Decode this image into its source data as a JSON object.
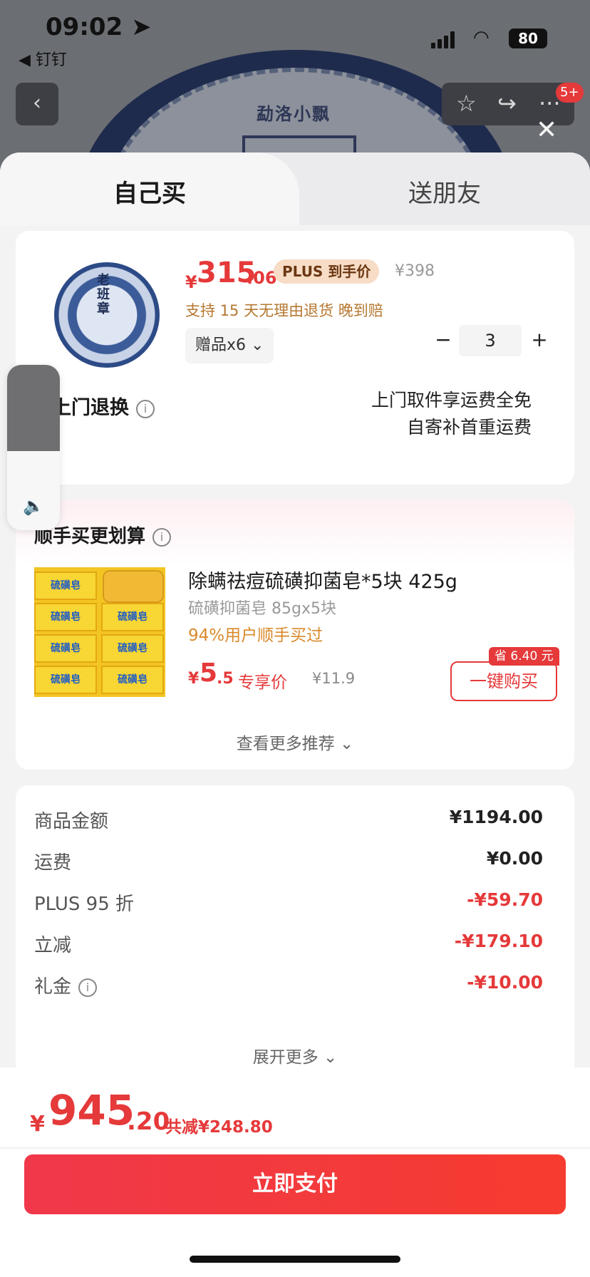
{
  "status_bar": {
    "time": "09:02",
    "back_app": "◀ 钉钉",
    "battery": "80"
  },
  "background": {
    "logo_text": "勐洛小飘",
    "badge": "5+"
  },
  "tabs": [
    {
      "label": "自己买",
      "active": true
    },
    {
      "label": "送朋友",
      "active": false
    }
  ],
  "product": {
    "image_text": "老班章",
    "currency": "¥",
    "price_int": "315",
    "price_dec": ".06",
    "plus_tag": "PLUS 到手价",
    "original_price": "¥398",
    "return_policy": "支持 15 天无理由退货   晚到赔",
    "gift": "赠品x6",
    "quantity": "3",
    "service_title": "费上门退换",
    "service_line1": "上门取件享运费全免",
    "service_line2": "自寄补首重运费"
  },
  "volume": {
    "level": 0.52
  },
  "cross_sell": {
    "title": "顺手买更划算",
    "item": {
      "name": "除螨祛痘硫磺抑菌皂*5块 425g",
      "spec": "硫磺抑菌皂 85gx5块",
      "social_proof": "94%用户顺手买过",
      "currency": "¥",
      "price_int": "5",
      "price_dec": ".5",
      "exclusive_label": "专享价",
      "original_price": "¥11.9",
      "save_tag": "省 6.40 元",
      "buy_label": "一键购买",
      "pack_text": "硫磺皂"
    },
    "more_label": "查看更多推荐 ⌄"
  },
  "summary": {
    "rows": [
      {
        "label": "商品金额",
        "value": "¥1194.00",
        "color": "#222222"
      },
      {
        "label": "运费",
        "value": "¥0.00",
        "color": "#222222"
      },
      {
        "label": "PLUS 95 折",
        "value": "-¥59.70",
        "color": "#e5393a"
      },
      {
        "label": "立减",
        "value": "-¥179.10",
        "color": "#e5393a"
      },
      {
        "label": "礼金",
        "value": "-¥10.00",
        "color": "#e5393a"
      }
    ],
    "expand_label": "展开更多 ⌄"
  },
  "footer": {
    "currency": "¥",
    "total_int": "945",
    "total_dec": ".20",
    "total_saved": "共减¥248.80",
    "pay_label": "立即支付"
  },
  "icons": [
    "location-arrow-icon",
    "signal-icon",
    "wifi-icon",
    "battery-icon",
    "back-icon",
    "star-icon",
    "share-icon",
    "more-icon",
    "close-icon",
    "info-icon",
    "chevron-down-icon",
    "speaker-icon"
  ],
  "colors": {
    "accent": "#e5393a",
    "plus_tag_bg": "#f7dcc6",
    "gold_text": "#b57730"
  }
}
